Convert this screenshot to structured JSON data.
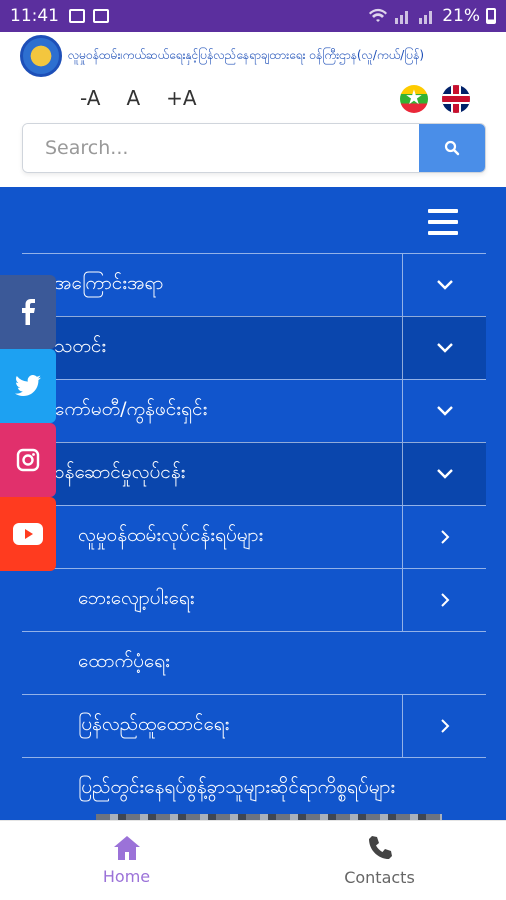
{
  "status_bar": {
    "time": "11:41",
    "battery": "21%"
  },
  "header": {
    "site_name": "လူမှုဝန်ထမ်း၊ကယ်ဆယ်ရေးနှင့်ပြန်လည်နေရာချထားရေး ဝန်ကြီးဌာန(လူ/ကယ်/ပြန်)"
  },
  "font_controls": {
    "decrease": "-A",
    "normal": "A",
    "increase": "+A"
  },
  "search": {
    "placeholder": "Search..."
  },
  "menu": {
    "items": [
      {
        "label": "အကြောင်းအရာ",
        "toggle": "chevron-down"
      },
      {
        "label": "သတင်း",
        "toggle": "chevron-down"
      },
      {
        "label": "ကော်မတီ/ကွန်ဖင်းရှင်း",
        "toggle": "chevron-down"
      },
      {
        "label": "ဝန်ဆောင်မှုလုပ်ငန်း",
        "toggle": "chevron-down"
      },
      {
        "label": "လူမှုဝန်ထမ်းလုပ်ငန်းရပ်များ",
        "toggle": "chevron-right"
      },
      {
        "label": "ဘေးလျော့ပါးရေး",
        "toggle": "chevron-right"
      },
      {
        "label": "ထောက်ပံ့ရေး",
        "toggle": ""
      },
      {
        "label": "ပြန်လည်ထူထောင်ရေး",
        "toggle": "chevron-right"
      },
      {
        "label": "ပြည်တွင်းနေရပ်စွန့်ခွာသူများဆိုင်ရာကိစ္စရပ်များ",
        "toggle": ""
      }
    ]
  },
  "bottom_nav": {
    "home": "Home",
    "contacts": "Contacts"
  },
  "colors": {
    "nav_blue": "#1155cc",
    "status_purple": "#5b2f9e",
    "accent_purple": "#9b72d8",
    "search_button": "#4a8ee8"
  }
}
